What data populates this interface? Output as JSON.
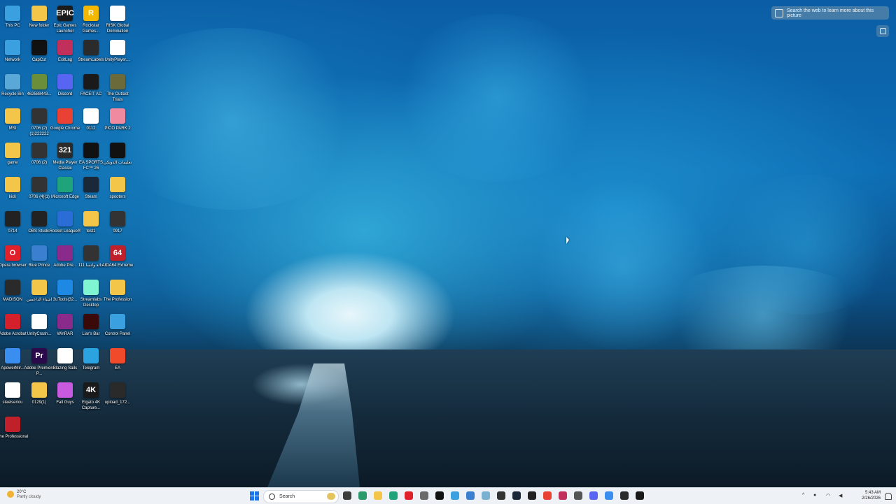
{
  "desktop": {
    "icons": [
      {
        "label": "This PC",
        "icon": "this-pc-icon",
        "color": "#3aa0e0"
      },
      {
        "label": "New folder",
        "icon": "folder-icon",
        "color": "#f3c64a"
      },
      {
        "label": "Epic Games Launcher",
        "icon": "epic-games-icon",
        "color": "#1b1b1b",
        "glyph": "EPIC"
      },
      {
        "label": "Rockstar Games...",
        "icon": "rockstar-icon",
        "color": "#f5b800",
        "glyph": "R"
      },
      {
        "label": "RISK Global Domination",
        "icon": "risk-icon",
        "color": "#ffffff",
        "glyph": "R"
      },
      {
        "label": "Network",
        "icon": "network-icon",
        "color": "#3aa0e0"
      },
      {
        "label": "CapCut",
        "icon": "capcut-icon",
        "color": "#111111"
      },
      {
        "label": "ExitLag",
        "icon": "exitlag-icon",
        "color": "#c0305a"
      },
      {
        "label": "StreamLabels",
        "icon": "streamlabels-icon",
        "color": "#2b2b2b"
      },
      {
        "label": "UnityPlayer....",
        "icon": "file-icon",
        "color": "#ffffff"
      },
      {
        "label": "Recycle Bin",
        "icon": "recycle-bin-icon",
        "color": "#5aa8d8"
      },
      {
        "label": "462588443...",
        "icon": "image-file-icon",
        "color": "#6b8e3a"
      },
      {
        "label": "Discord",
        "icon": "discord-icon",
        "color": "#5865f2"
      },
      {
        "label": "FACEIT AC",
        "icon": "faceit-icon",
        "color": "#1a1a1a"
      },
      {
        "label": "The Outlast Trials",
        "icon": "outlast-icon",
        "color": "#6a6a3a"
      },
      {
        "label": "MSI",
        "icon": "folder-icon",
        "color": "#f3c64a"
      },
      {
        "label": "0706 (2)(1)222222",
        "icon": "video-file-icon",
        "color": "#333333"
      },
      {
        "label": "Google Chrome",
        "icon": "chrome-icon",
        "color": "#e94235"
      },
      {
        "label": "0112",
        "icon": "video-player-icon",
        "color": "#ffffff"
      },
      {
        "label": "PICO PARK 2",
        "icon": "pico-park-icon",
        "color": "#f08aa0"
      },
      {
        "label": "game",
        "icon": "folder-icon",
        "color": "#f3c64a"
      },
      {
        "label": "0706 (2)",
        "icon": "video-file-icon",
        "color": "#333333"
      },
      {
        "label": "Media Player Classic",
        "icon": "media-player-icon",
        "color": "#2b2b2b",
        "glyph": "321"
      },
      {
        "label": "EA SPORTS FC™ 26",
        "icon": "ea-sports-fc-icon",
        "color": "#111111"
      },
      {
        "label": "تعليمات الدونكي",
        "icon": "folder-icon",
        "color": "#111111"
      },
      {
        "label": "kick",
        "icon": "folder-icon",
        "color": "#f3c64a"
      },
      {
        "label": "0706 (4)(1)",
        "icon": "video-file-icon",
        "color": "#333333"
      },
      {
        "label": "Microsoft Edge",
        "icon": "edge-icon",
        "color": "#1fa37a"
      },
      {
        "label": "Steam",
        "icon": "steam-icon",
        "color": "#1b2838"
      },
      {
        "label": "spooters",
        "icon": "folder-icon",
        "color": "#f3c64a"
      },
      {
        "label": "0714",
        "icon": "video-file-icon",
        "color": "#222222"
      },
      {
        "label": "OBS Studio",
        "icon": "obs-icon",
        "color": "#222222"
      },
      {
        "label": "Rocket League®",
        "icon": "rocket-league-icon",
        "color": "#2a6dd6"
      },
      {
        "label": "test1",
        "icon": "folder-icon",
        "color": "#f3c64a"
      },
      {
        "label": "0917",
        "icon": "video-file-icon",
        "color": "#333333"
      },
      {
        "label": "Opera browser",
        "icon": "opera-icon",
        "color": "#e0202a",
        "glyph": "O"
      },
      {
        "label": "Blue Prince",
        "icon": "blue-prince-icon",
        "color": "#3a7fd0"
      },
      {
        "label": "Adobe Pre...",
        "icon": "winrar-archive-icon",
        "color": "#8a2a8a"
      },
      {
        "label": "حالة واتسا 111",
        "icon": "video-file-icon",
        "color": "#333333"
      },
      {
        "label": "AIDA64 Extreme",
        "icon": "aida64-icon",
        "color": "#c0202a",
        "glyph": "64"
      },
      {
        "label": "MADISON",
        "icon": "madison-icon",
        "color": "#2a2a2a"
      },
      {
        "label": "اشياء الداعمين",
        "icon": "folder-icon",
        "color": "#f3c64a"
      },
      {
        "label": "3uTools(32...",
        "icon": "3utools-icon",
        "color": "#1e88e5"
      },
      {
        "label": "Streamlabs Desktop",
        "icon": "streamlabs-icon",
        "color": "#80f5d2"
      },
      {
        "label": "The Profession",
        "icon": "folder-icon",
        "color": "#f3c64a"
      },
      {
        "label": "Adobe Acrobat",
        "icon": "acrobat-icon",
        "color": "#d4202a"
      },
      {
        "label": "UnityCrash...",
        "icon": "unity-icon",
        "color": "#ffffff"
      },
      {
        "label": "WinRAR",
        "icon": "winrar-icon",
        "color": "#8a2a8a"
      },
      {
        "label": "Liar's Bar",
        "icon": "liars-bar-icon",
        "color": "#3a0a0a"
      },
      {
        "label": "Control Panel",
        "icon": "control-panel-icon",
        "color": "#3aa0e0"
      },
      {
        "label": "ApowerMir...",
        "icon": "apowermirror-icon",
        "color": "#3a8ef0"
      },
      {
        "label": "Adobe Premiere P...",
        "icon": "premiere-icon",
        "color": "#2a0a4a",
        "glyph": "Pr"
      },
      {
        "label": "Blazing Sails",
        "icon": "blazing-sails-icon",
        "color": "#ffffff"
      },
      {
        "label": "Telegram",
        "icon": "telegram-icon",
        "color": "#2aa3e0"
      },
      {
        "label": "EA",
        "icon": "ea-icon",
        "color": "#f04a2a"
      },
      {
        "label": "steelseriou",
        "icon": "file-icon",
        "color": "#ffffff"
      },
      {
        "label": "0129(1)",
        "icon": "folder-icon",
        "color": "#f3c64a"
      },
      {
        "label": "Fall Guys",
        "icon": "fall-guys-icon",
        "color": "#c85adf"
      },
      {
        "label": "Elgato 4K Capture...",
        "icon": "elgato-icon",
        "color": "#1a1a1a",
        "glyph": "4K"
      },
      {
        "label": "upload_172...",
        "icon": "video-file-icon",
        "color": "#2a2a2a"
      },
      {
        "label": "The Professional",
        "icon": "the-professional-icon",
        "color": "#c0202a"
      }
    ]
  },
  "lens": {
    "pill_text": "Search the web to learn more about this picture"
  },
  "taskbar": {
    "weather_temp": "20°C",
    "weather_condition": "Partly cloudy",
    "search_placeholder": "Search",
    "apps": [
      {
        "icon": "file-explorer-icon",
        "color": "#3c3c3c"
      },
      {
        "icon": "photos-icon",
        "color": "#2b9a6a"
      },
      {
        "icon": "folder-icon",
        "color": "#f3c64a"
      },
      {
        "icon": "edge-icon",
        "color": "#1fa37a"
      },
      {
        "icon": "opera-icon",
        "color": "#e0202a"
      },
      {
        "icon": "settings-icon",
        "color": "#6a6a6a"
      },
      {
        "icon": "capcut-icon",
        "color": "#111111"
      },
      {
        "icon": "notepad-icon",
        "color": "#3aa0e0"
      },
      {
        "icon": "calculator-icon",
        "color": "#3a7fd0"
      },
      {
        "icon": "snipping-icon",
        "color": "#7ab0d0"
      },
      {
        "icon": "streamlabs-icon",
        "color": "#333333"
      },
      {
        "icon": "steam-icon",
        "color": "#1b2838"
      },
      {
        "icon": "obs-icon",
        "color": "#222222"
      },
      {
        "icon": "chrome-icon",
        "color": "#e94235"
      },
      {
        "icon": "exitlag-icon",
        "color": "#c0305a"
      },
      {
        "icon": "sound-icon",
        "color": "#555555"
      },
      {
        "icon": "discord-icon",
        "color": "#5865f2"
      },
      {
        "icon": "apowermirror-icon",
        "color": "#3a8ef0"
      },
      {
        "icon": "streamlabels-icon",
        "color": "#2b2b2b"
      },
      {
        "icon": "faceit-icon",
        "color": "#1a1a1a"
      }
    ],
    "clock_time": "5:43 AM",
    "clock_date": "2/26/2026"
  }
}
